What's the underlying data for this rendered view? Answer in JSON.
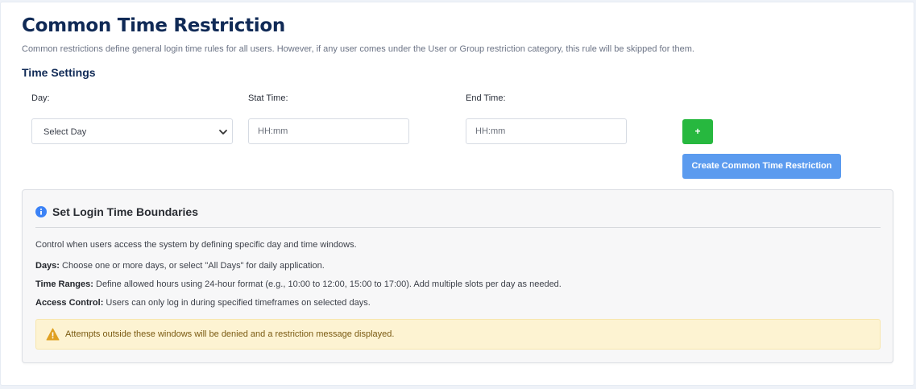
{
  "header": {
    "title": "Common Time Restriction",
    "description": "Common restrictions define general login time rules for all users. However, if any user comes under the User or Group restriction category, this rule will be skipped for them."
  },
  "time_settings": {
    "title": "Time Settings",
    "day_label": "Day:",
    "day_select_value": "Select Day",
    "start_label": "Stat Time:",
    "start_placeholder": "HH:mm",
    "end_label": "End Time:",
    "end_placeholder": "HH:mm",
    "add_button": "+",
    "create_button": "Create Common Time Restriction"
  },
  "info": {
    "icon": "info-circle-icon",
    "title": "Set Login Time Boundaries",
    "intro": "Control when users access the system by defining specific day and time windows.",
    "items": [
      {
        "term": "Days:",
        "text": " Choose one or more days, or select \"All Days\" for daily application."
      },
      {
        "term": "Time Ranges:",
        "text": " Define allowed hours using 24-hour format (e.g., 10:00 to 12:00, 15:00 to 17:00). Add multiple slots per day as needed."
      },
      {
        "term": "Access Control:",
        "text": " Users can only log in during specified timeframes on selected days."
      }
    ],
    "warning": {
      "icon": "warning-triangle-icon",
      "text": "Attempts outside these windows will be denied and a restriction message displayed."
    }
  },
  "colors": {
    "title": "#102a56",
    "add_button": "#27b83f",
    "create_button": "#5b9bef",
    "info_icon": "#3b82f6",
    "warning_bg": "#fdf3d2",
    "warning_icon": "#e0a020"
  }
}
